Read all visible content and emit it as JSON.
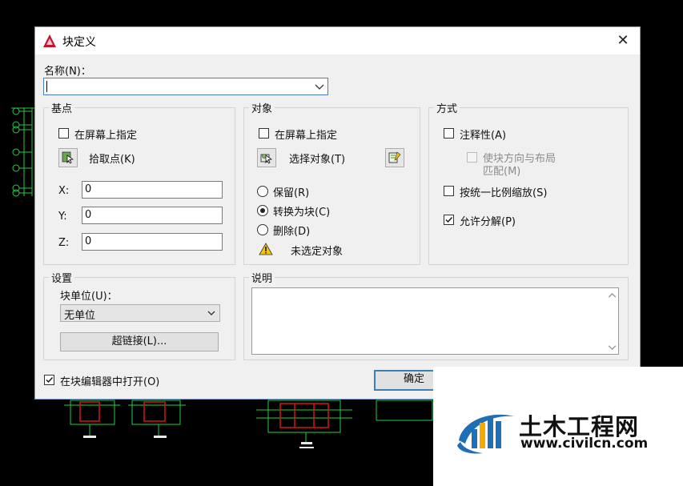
{
  "dialog": {
    "title": "块定义",
    "close_glyph": "✕",
    "name_label": "名称(N)：",
    "name_value": ""
  },
  "base_point": {
    "title": "基点",
    "specify_on_screen": "在屏幕上指定",
    "specify_checked": false,
    "pick_point": "拾取点(K)",
    "x_label": "X:",
    "y_label": "Y:",
    "z_label": "Z:",
    "x_value": "0",
    "y_value": "0",
    "z_value": "0"
  },
  "objects": {
    "title": "对象",
    "specify_on_screen": "在屏幕上指定",
    "specify_checked": false,
    "select_objects": "选择对象(T)",
    "retain": "保留(R)",
    "convert": "转换为块(C)",
    "delete": "删除(D)",
    "selected_option": "convert",
    "warning": "未选定对象"
  },
  "behavior": {
    "title": "方式",
    "annotative": "注释性(A)",
    "annotative_checked": false,
    "match_orientation_line1": "使块方向与布局",
    "match_orientation_line2": "匹配(M)",
    "match_checked": false,
    "scale_uniformly": "按统一比例缩放(S)",
    "scale_checked": false,
    "allow_explode": "允许分解(P)",
    "explode_checked": true
  },
  "settings": {
    "title": "设置",
    "block_unit_label": "块单位(U)：",
    "block_unit_value": "无单位",
    "hyperlink": "超链接(L)..."
  },
  "description": {
    "title": "说明",
    "value": ""
  },
  "footer": {
    "open_in_editor": "在块编辑器中打开(O)",
    "open_checked": true,
    "ok": "确定"
  },
  "watermark": {
    "name": "土木工程网",
    "url": "www.civilcn.com"
  },
  "colors": {
    "accent": "#3c7fb1",
    "cad_green": "#22cc44",
    "cad_red": "#d01818",
    "autocad_red": "#c8102e"
  }
}
